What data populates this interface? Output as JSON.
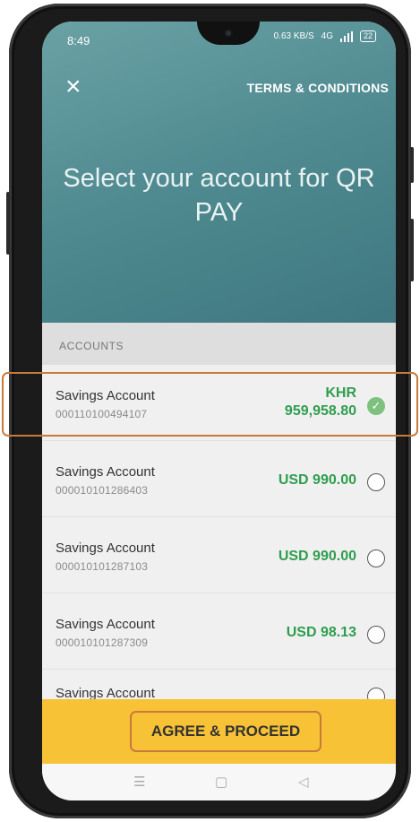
{
  "status": {
    "time": "8:49",
    "data_speed": "0.63 KB/S",
    "network": "4G",
    "battery": "22"
  },
  "header": {
    "close_icon": "×",
    "terms": "TERMS & CONDITIONS",
    "title": "Select your account for QR PAY"
  },
  "section": {
    "label": "ACCOUNTS"
  },
  "accounts": [
    {
      "name": "Savings Account",
      "number": "000110100494107",
      "currency": "KHR",
      "amount": "959,958.80",
      "selected": true
    },
    {
      "name": "Savings Account",
      "number": "000010101286403",
      "balance": "USD 990.00",
      "selected": false
    },
    {
      "name": "Savings Account",
      "number": "000010101287103",
      "balance": "USD 990.00",
      "selected": false
    },
    {
      "name": "Savings Account",
      "number": "000010101287309",
      "balance": "USD 98.13",
      "selected": false
    },
    {
      "name": "Savings Account"
    }
  ],
  "cta": {
    "label": "AGREE & PROCEED"
  },
  "nav": {
    "menu": "☰",
    "home": "▢",
    "back": "◁"
  },
  "colors": {
    "header": "#4f8a90",
    "amount": "#2e9e4e",
    "cta": "#f7c235",
    "highlight": "#c87a3a"
  }
}
